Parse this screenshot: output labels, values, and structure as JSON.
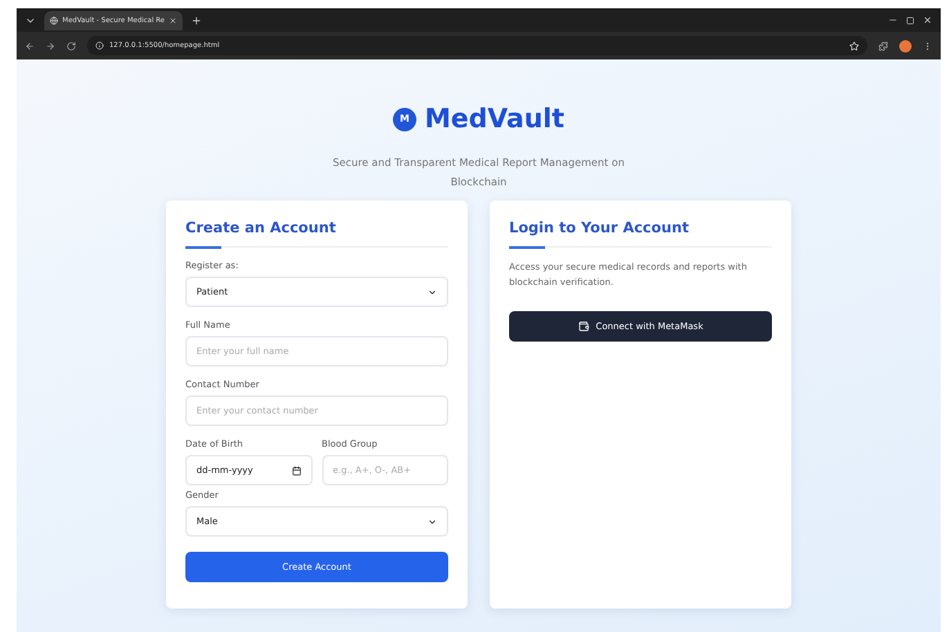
{
  "browser": {
    "tab_title": "MedVault - Secure Medical Re",
    "url": "127.0.0.1:5500/homepage.html"
  },
  "brand": {
    "logo_letter": "M",
    "name": "MedVault",
    "tagline": "Secure and Transparent Medical Report Management on Blockchain"
  },
  "register": {
    "title": "Create an Account",
    "fields": [
      {
        "kind": "select",
        "label": "Register as:",
        "value": "Patient"
      },
      {
        "kind": "text",
        "label": "Full Name",
        "placeholder": "Enter your full name"
      },
      {
        "kind": "text",
        "label": "Contact Number",
        "placeholder": "Enter your contact number"
      },
      {
        "kind": "pair",
        "items": [
          {
            "kind": "date",
            "label": "Date of Birth",
            "value": "dd-mm-yyyy"
          },
          {
            "kind": "text",
            "label": "Blood Group",
            "placeholder": "e.g., A+, O-, AB+"
          }
        ]
      },
      {
        "kind": "select",
        "label": "Gender",
        "value": "Male"
      }
    ],
    "button": "Create Account"
  },
  "login": {
    "title": "Login to Your Account",
    "description": "Access your secure medical records and reports with blockchain verification.",
    "button": "Connect with MetaMask"
  }
}
